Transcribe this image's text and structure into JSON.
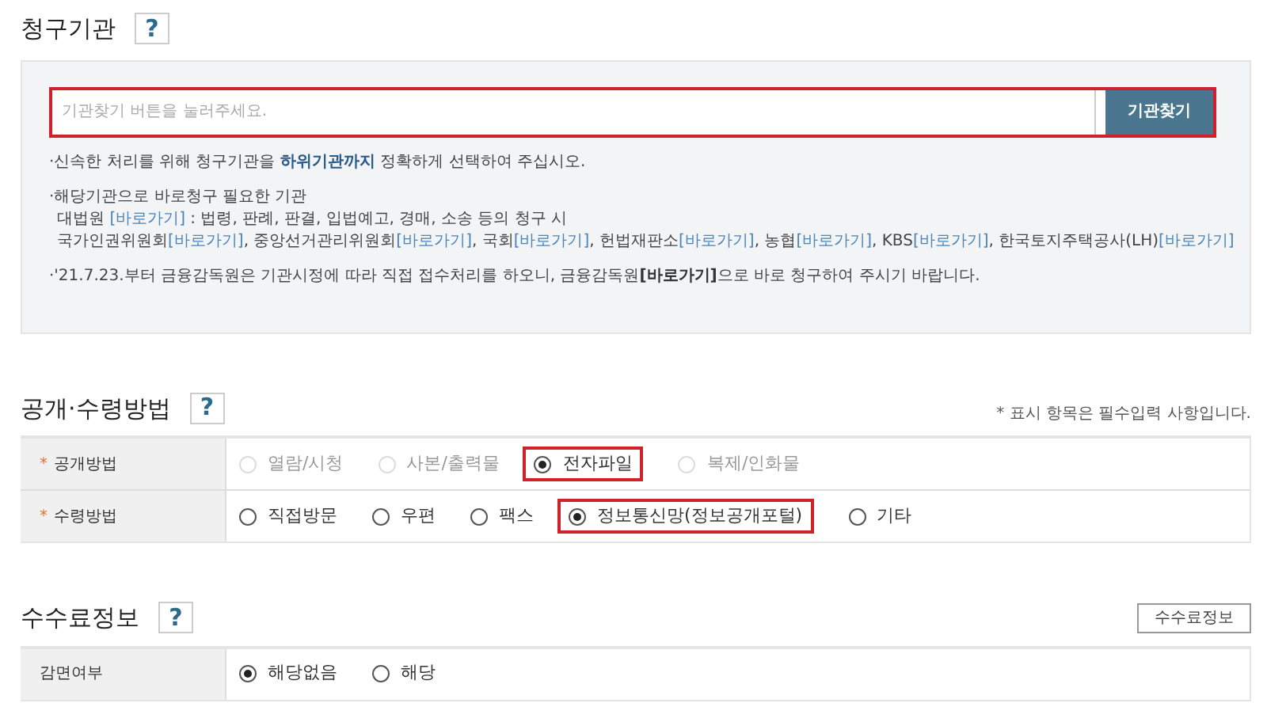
{
  "sections": [
    {
      "title": "청구기관",
      "help": "?",
      "kind": "agency",
      "search": {
        "placeholder": "기관찾기 버튼을 눌러주세요.",
        "button": "기관찾기",
        "highlighted": true
      },
      "notes": [
        {
          "lines": [
            [
              {
                "kind": "text",
                "text": "·신속한 처리를 위해 청구기관을 "
              },
              {
                "kind": "emphasis",
                "text": "하위기관까지"
              },
              {
                "kind": "text",
                "text": " 정확하게 선택하여 주십시오."
              }
            ]
          ]
        },
        {
          "lines": [
            [
              {
                "kind": "text",
                "text": "·해당기관으로 바로청구 필요한 기관"
              }
            ],
            [
              {
                "kind": "text",
                "text": "대법원 "
              },
              {
                "kind": "link",
                "text": "[바로가기]"
              },
              {
                "kind": "text",
                "text": " : 법령, 판례, 판결, 입법예고, 경매, 소송 등의 청구 시"
              }
            ],
            [
              {
                "kind": "text",
                "text": "국가인권위원회"
              },
              {
                "kind": "link",
                "text": "[바로가기]"
              },
              {
                "kind": "text",
                "text": ", 중앙선거관리위원회"
              },
              {
                "kind": "link",
                "text": "[바로가기]"
              },
              {
                "kind": "text",
                "text": ", 국회"
              },
              {
                "kind": "link",
                "text": "[바로가기]"
              },
              {
                "kind": "text",
                "text": ", 헌법재판소"
              },
              {
                "kind": "link",
                "text": "[바로가기]"
              },
              {
                "kind": "text",
                "text": ", 농협"
              },
              {
                "kind": "link",
                "text": "[바로가기]"
              },
              {
                "kind": "text",
                "text": ", KBS"
              },
              {
                "kind": "link",
                "text": "[바로가기]"
              },
              {
                "kind": "text",
                "text": ", 한국토지주택공사(LH)"
              },
              {
                "kind": "link",
                "text": "[바로가기]"
              }
            ]
          ]
        },
        {
          "lines": [
            [
              {
                "kind": "text",
                "text": "·'21.7.23.부터 금융감독원은 기관시정에 따라 직접 접수처리를 하오니, 금융감독원"
              },
              {
                "kind": "strong-link",
                "text": "[바로가기]"
              },
              {
                "kind": "text",
                "text": "으로 바로 청구하여 주시기 바랍니다."
              }
            ]
          ]
        }
      ]
    },
    {
      "title": "공개·수령방법",
      "help": "?",
      "kind": "table",
      "required_note": "* 표시 항목은 필수입력 사항입니다.",
      "rows": [
        {
          "label": "공개방법",
          "required_mark": "*",
          "options": [
            {
              "label": "열람/시청",
              "selected": false,
              "disabled": true,
              "highlighted": false
            },
            {
              "label": "사본/출력물",
              "selected": false,
              "disabled": true,
              "highlighted": false
            },
            {
              "label": "전자파일",
              "selected": true,
              "disabled": false,
              "highlighted": true
            },
            {
              "label": "복제/인화물",
              "selected": false,
              "disabled": true,
              "highlighted": false
            }
          ]
        },
        {
          "label": "수령방법",
          "required_mark": "*",
          "options": [
            {
              "label": "직접방문",
              "selected": false,
              "disabled": false,
              "highlighted": false
            },
            {
              "label": "우편",
              "selected": false,
              "disabled": false,
              "highlighted": false
            },
            {
              "label": "팩스",
              "selected": false,
              "disabled": false,
              "highlighted": false
            },
            {
              "label": "정보통신망(정보공개포털)",
              "selected": true,
              "disabled": false,
              "highlighted": true
            },
            {
              "label": "기타",
              "selected": false,
              "disabled": false,
              "highlighted": false
            }
          ]
        }
      ]
    },
    {
      "title": "수수료정보",
      "help": "?",
      "kind": "table",
      "side_button": "수수료정보",
      "rows": [
        {
          "label": "감면여부",
          "options": [
            {
              "label": "해당없음",
              "selected": true,
              "disabled": false,
              "highlighted": false
            },
            {
              "label": "해당",
              "selected": false,
              "disabled": false,
              "highlighted": false
            }
          ]
        }
      ]
    }
  ]
}
